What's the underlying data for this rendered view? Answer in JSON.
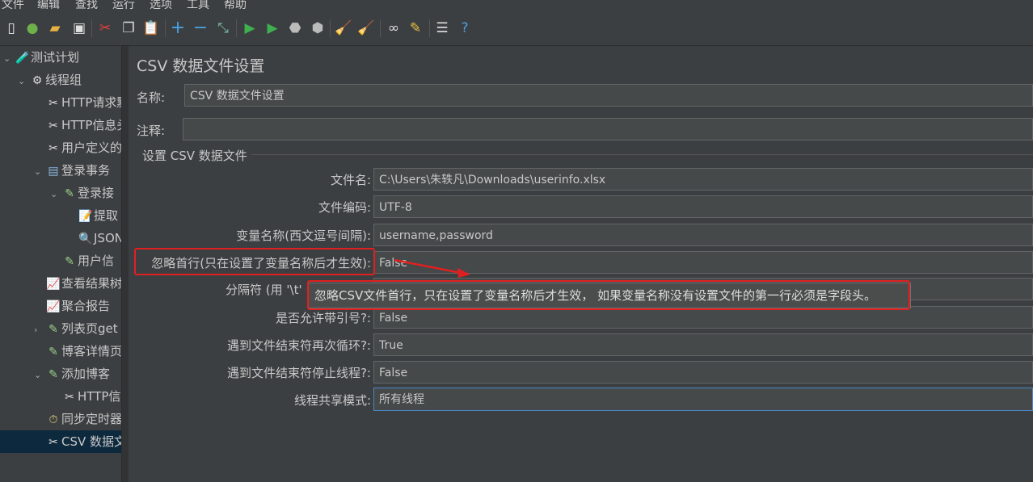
{
  "menu": [
    "文件",
    "编辑",
    "查找",
    "运行",
    "选项",
    "工具",
    "帮助"
  ],
  "tree": [
    {
      "label": "测试计划",
      "arrow": "⌄",
      "icon": "flask-icon",
      "glyph": "🧪"
    },
    {
      "label": "线程组",
      "arrow": "⌄",
      "icon": "gear-icon",
      "glyph": "⚙"
    },
    {
      "label": "HTTP请求默",
      "arrow": "",
      "icon": "tools-icon",
      "glyph": "✂"
    },
    {
      "label": "HTTP信息头",
      "arrow": "",
      "icon": "tools-icon",
      "glyph": "✂"
    },
    {
      "label": "用户定义的",
      "arrow": "",
      "icon": "tools-icon",
      "glyph": "✂"
    },
    {
      "label": "登录事务",
      "arrow": "⌄",
      "icon": "transaction-icon",
      "glyph": "▤"
    },
    {
      "label": "登录接",
      "arrow": "⌄",
      "icon": "sampler-icon",
      "glyph": "✎"
    },
    {
      "label": "提取",
      "arrow": "",
      "icon": "extractor-icon",
      "glyph": "📝"
    },
    {
      "label": "JSON",
      "arrow": "",
      "icon": "assertion-icon",
      "glyph": "🔍"
    },
    {
      "label": "用户信",
      "arrow": "",
      "icon": "sampler-icon",
      "glyph": "✎"
    },
    {
      "label": "查看结果树",
      "arrow": "",
      "icon": "chart-icon",
      "glyph": "📈"
    },
    {
      "label": "聚合报告",
      "arrow": "",
      "icon": "chart-icon",
      "glyph": "📈"
    },
    {
      "label": "列表页get",
      "arrow": "›",
      "icon": "sampler-icon",
      "glyph": "✎"
    },
    {
      "label": "博客详情页",
      "arrow": "",
      "icon": "sampler-icon",
      "glyph": "✎"
    },
    {
      "label": "添加博客",
      "arrow": "⌄",
      "icon": "sampler-icon",
      "glyph": "✎"
    },
    {
      "label": "HTTP信",
      "arrow": "",
      "icon": "tools-icon",
      "glyph": "✂"
    },
    {
      "label": "同步定时器",
      "arrow": "",
      "icon": "timer-icon",
      "glyph": "⏱"
    },
    {
      "label": "CSV 数据文",
      "arrow": "",
      "icon": "tools-icon",
      "glyph": "✂"
    }
  ],
  "panel": {
    "title": "CSV 数据文件设置",
    "name_label": "名称:",
    "name_value": "CSV 数据文件设置",
    "comment_label": "注释:",
    "comment_value": "",
    "group_title": "设置 CSV 数据文件",
    "fields": [
      {
        "label": "文件名:",
        "value": "C:\\Users\\朱轶凡\\Downloads\\userinfo.xlsx"
      },
      {
        "label": "文件编码:",
        "value": "UTF-8"
      },
      {
        "label": "变量名称(西文逗号间隔):",
        "value": "username,password"
      },
      {
        "label": "忽略首行(只在设置了变量名称后才生效):",
        "value": "False"
      },
      {
        "label": "分隔符 (用 '\\t' 代替制表符):",
        "value": ","
      },
      {
        "label": "是否允许带引号?:",
        "value": "False"
      },
      {
        "label": "遇到文件结束符再次循环?:",
        "value": "True"
      },
      {
        "label": "遇到文件结束符停止线程?:",
        "value": "False"
      },
      {
        "label": "线程共享模式:",
        "value": "所有线程"
      }
    ],
    "tooltip": "忽略CSV文件首行，只在设置了变量名称后才生效， 如果变量名称没有设置文件的第一行必须是字段头。"
  },
  "colors": {
    "annotation": "#e02020",
    "selected": "#0d293e",
    "focus": "#4a88c7"
  }
}
